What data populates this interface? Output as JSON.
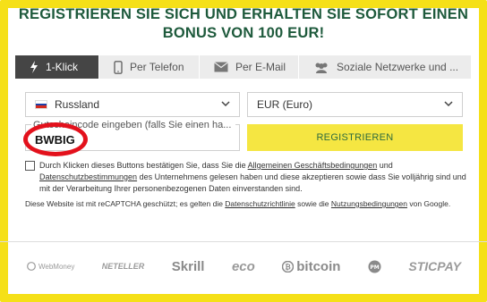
{
  "header": {
    "line1": "REGISTRIEREN SIE SICH UND ERHALTEN SIE SOFORT EINEN",
    "line2": "BONUS VON 100 EUR!"
  },
  "tabs": [
    {
      "label": "1-Klick",
      "icon": "lightning-icon",
      "active": true
    },
    {
      "label": "Per Telefon",
      "icon": "phone-icon",
      "active": false
    },
    {
      "label": "Per E-Mail",
      "icon": "envelope-icon",
      "active": false
    },
    {
      "label": "Soziale Netzwerke und ...",
      "icon": "users-icon",
      "active": false
    }
  ],
  "form": {
    "country": "Russland",
    "currency": "EUR (Euro)",
    "promo_placeholder": "Gutscheincode eingeben (falls Sie einen ha...",
    "promo_value": "BWBIG",
    "register_label": "REGISTRIEREN"
  },
  "consent": {
    "pre": "Durch Klicken dieses Buttons bestätigen Sie, dass Sie die ",
    "link1": "Allgemeinen Geschäftsbedingungen",
    "mid1": " und ",
    "link2": "Datenschutzbestimmungen",
    "post": " des Unternehmens gelesen haben und diese akzeptieren sowie dass Sie volljährig sind und mit der Verarbeitung Ihrer personenbezogenen Daten einverstanden sind."
  },
  "captcha": {
    "pre": "Diese Website ist mit reCAPTCHA geschützt; es gelten die ",
    "link1": "Datenschutzrichtlinie",
    "mid": " sowie die ",
    "link2": "Nutzungsbedingungen",
    "post": " von Google."
  },
  "payments": [
    "WebMoney",
    "NETELLER",
    "Skrill",
    "eco",
    "bitcoin",
    "PM",
    "STICPAY"
  ],
  "colors": {
    "frame": "#f5e018",
    "title": "#1e5a3c",
    "active_tab": "#454545",
    "button": "#f5e642",
    "highlight": "#e3111c"
  }
}
